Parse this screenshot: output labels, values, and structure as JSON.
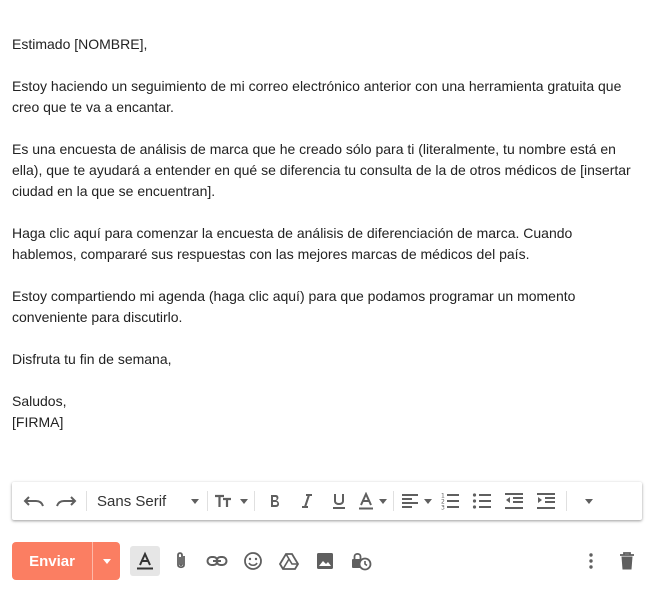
{
  "email": {
    "greeting": "Estimado [NOMBRE],",
    "p1": "Estoy haciendo un seguimiento de mi correo electrónico anterior con una herramienta gratuita que creo que te va a encantar.",
    "p2": "Es una encuesta de análisis de marca que he creado sólo para ti (literalmente, tu nombre está en ella), que te ayudará a entender en qué se diferencia tu consulta de la de otros médicos de [insertar ciudad en la que se encuentran].",
    "p3": "Haga clic aquí para comenzar la encuesta de análisis de diferenciación de marca. Cuando hablemos, compararé sus respuestas con las mejores marcas de médicos del país.",
    "p4": "Estoy compartiendo mi agenda (haga clic aquí) para que podamos programar un momento conveniente para discutirlo.",
    "p5": "Disfruta tu fin de semana,",
    "closing": "Saludos,",
    "signature": "[FIRMA]"
  },
  "toolbar": {
    "font_family": "Sans Serif",
    "icons": [
      "undo-icon",
      "redo-icon",
      "text-size-icon",
      "bold-icon",
      "italic-icon",
      "underline-icon",
      "text-color-icon",
      "align-icon",
      "numbered-list-icon",
      "bulleted-list-icon",
      "indent-less-icon",
      "indent-more-icon",
      "more-options-icon"
    ]
  },
  "bottom_bar": {
    "send_label": "Enviar",
    "send_color": "#fb7e62",
    "icons": [
      "formatting-icon",
      "attach-icon",
      "link-icon",
      "emoji-icon",
      "drive-icon",
      "photo-icon",
      "confidential-icon",
      "more-vert-icon",
      "trash-icon"
    ]
  }
}
